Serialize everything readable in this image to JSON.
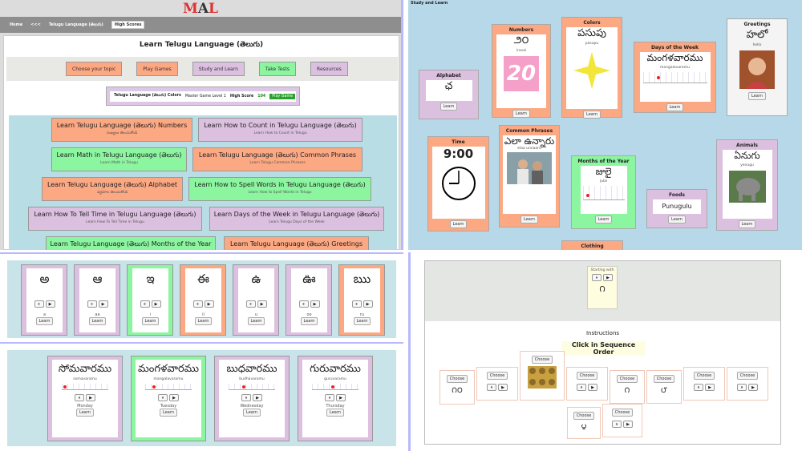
{
  "site": {
    "logo": "MAL"
  },
  "nav": {
    "home": "Home",
    "back": "<<<",
    "lang": "Telugu Language (తెలుగు)",
    "high_scores": "High Scores"
  },
  "main": {
    "title": "Learn Telugu Language (తెలుగు)",
    "tabs": [
      "Choose your topic",
      "Play Games",
      "Study and Learn",
      "Take Tests",
      "Resources"
    ],
    "score": {
      "game": "Telugu Language (తెలుగు) Colors",
      "level": "Master Game Level 1",
      "label": "High Score",
      "value": "104",
      "play": "Play Game"
    },
    "lessons": [
      {
        "t": "Learn Telugu Language (తెలుగు) Numbers",
        "s": "సంఖ్యలు తెలుసుకోండి"
      },
      {
        "t": "Learn How to Count in Telugu Language (తెలుగు)",
        "s": "Learn How to Count in Telugu"
      },
      {
        "t": "Learn Math in Telugu Language (తెలుగు)",
        "s": "Learn Math in Telugu"
      },
      {
        "t": "Learn Telugu Language (తెలుగు) Common Phrases",
        "s": "Learn Telugu Common Phrases"
      },
      {
        "t": "Learn Telugu Language (తెలుగు) Alphabet",
        "s": "వర్ణమాల తెలుసుకోండి"
      },
      {
        "t": "Learn How to Spell Words in Telugu Language (తెలుగు)",
        "s": "Learn How to Spell Words in Telugu"
      },
      {
        "t": "Learn How To Tell Time in Telugu Language (తెలుగు)",
        "s": "Learn How To Tell Time in Telugu"
      },
      {
        "t": "Learn Days of the Week in Telugu Language (తెలుగు)",
        "s": "Learn Telugu Days of the Week"
      },
      {
        "t": "Learn Telugu Language (తెలుగు) Months of the Year",
        "s": ""
      },
      {
        "t": "Learn Telugu Language (తెలుగు) Greetings",
        "s": ""
      }
    ]
  },
  "study": {
    "title": "Study and Learn",
    "learn": "Learn",
    "cards": {
      "alphabet": {
        "t": "Alphabet",
        "w": "ఛ"
      },
      "numbers": {
        "t": "Numbers",
        "w": "౨౦",
        "tl": "iravai",
        "img": "20"
      },
      "colors": {
        "t": "Colors",
        "w": "పసుపు",
        "tl": "pasupu"
      },
      "days": {
        "t": "Days of the Week",
        "w": "మంగళవారము",
        "tl": "mangalavaramu"
      },
      "greetings": {
        "t": "Greetings",
        "w": "హలో",
        "tl": "hello"
      },
      "time": {
        "t": "Time",
        "w": "9:00"
      },
      "phrases": {
        "t": "Common Phrases",
        "w": "ఎలా ఉన్నారు",
        "tl": "elaa unnaaru"
      },
      "months": {
        "t": "Months of the Year",
        "w": "జులై",
        "tl": "julai"
      },
      "foods": {
        "t": "Foods",
        "w": "Punugulu"
      },
      "animals": {
        "t": "Animals",
        "w": "ఏనుగు",
        "tl": "yenugu"
      },
      "clothing": {
        "t": "Clothing"
      }
    }
  },
  "alphabet_row": [
    {
      "g": "అ",
      "tr": "a"
    },
    {
      "g": "ఆ",
      "tr": "aa"
    },
    {
      "g": "ఇ",
      "tr": "i"
    },
    {
      "g": "ఈ",
      "tr": "ii"
    },
    {
      "g": "ఉ",
      "tr": "u"
    },
    {
      "g": "ఊ",
      "tr": "oo"
    },
    {
      "g": "ఋ",
      "tr": "ru"
    }
  ],
  "days_row": [
    {
      "g": "సోమవారము",
      "tr": "somavaramu",
      "en": "Monday"
    },
    {
      "g": "మంగళవారము",
      "tr": "mangalavaramu",
      "en": "Tuesday"
    },
    {
      "g": "బుధవారము",
      "tr": "budhavaramu",
      "en": "Wednesday"
    },
    {
      "g": "గురువారము",
      "tr": "guruvaramu",
      "en": "Thursday"
    }
  ],
  "sequence": {
    "starting": "Starting with",
    "start_glyph": "౧",
    "instructions": "Instructions",
    "prompt": "Click in Sequence Order",
    "choose": "Choose",
    "choices": [
      "౧౦",
      "",
      "",
      "",
      "౧",
      "౮",
      "",
      "",
      "౪",
      ""
    ]
  },
  "controls": {
    "pause": "⏸",
    "play": "▶"
  },
  "colors": {
    "orange": "#fca882",
    "purple": "#dcc0e0",
    "green": "#8cf5a0",
    "bg_blue": "#b6d8e8"
  }
}
